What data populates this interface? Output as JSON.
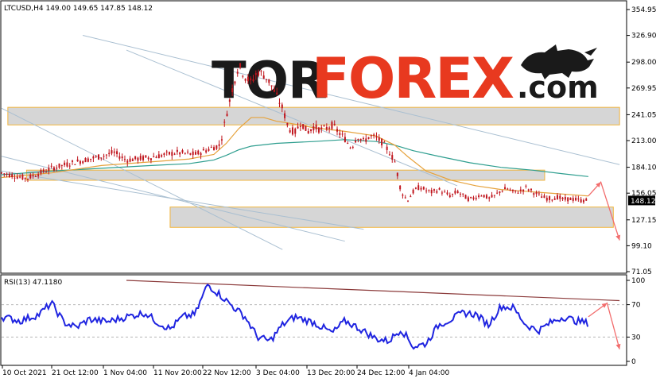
{
  "symbol_header": {
    "text": "LTCUSD,H4  149.00 149.65 147.85 148.12"
  },
  "watermark": {
    "brand_dark": "TOR",
    "brand_red": "FOREX",
    "suffix": ".com",
    "dark_color": "#1a1a1a",
    "red_color": "#e8391f"
  },
  "colors": {
    "background": "#ffffff",
    "candle": "#c0151d",
    "ma_fast": "#e6a23c",
    "ma_slow": "#2e9e8f",
    "zone_fill": "#d6d6d6",
    "zone_stroke": "#f0b43c",
    "trendline": "#a9bfd1",
    "arrow": "#f26d6d",
    "rsi_line": "#1f24e0",
    "rsi_trend": "#8b3a3a",
    "grid_dash": "#b8b8b8"
  },
  "chart_data": [
    {
      "type": "line",
      "title": "LTCUSD,H4",
      "ohlc_last": {
        "open": 149.0,
        "high": 149.65,
        "low": 147.85,
        "close": 148.12
      },
      "current_price_label": "148.12",
      "y_ticks": [
        "354.95",
        "326.90",
        "298.00",
        "269.95",
        "241.05",
        "213.00",
        "184.10",
        "156.05",
        "127.15",
        "99.10",
        "71.05"
      ],
      "y_tick_values": [
        354.95,
        326.9,
        298.0,
        269.95,
        241.05,
        213.0,
        184.1,
        156.05,
        127.15,
        99.1,
        71.05
      ],
      "ylim": [
        71.05,
        354.95
      ],
      "x_ticks": [
        "10 Oct 2021",
        "21 Oct 12:00",
        "1 Nov 04:00",
        "11 Nov 20:00",
        "22 Nov 12:00",
        "3 Dec 04:00",
        "13 Dec 20:00",
        "24 Dec 12:00",
        "4 Jan 04:00"
      ],
      "price_path": [
        [
          0,
          178
        ],
        [
          4,
          172
        ],
        [
          8,
          183
        ],
        [
          12,
          190
        ],
        [
          16,
          196
        ],
        [
          18,
          200
        ],
        [
          20,
          192
        ],
        [
          24,
          195
        ],
        [
          28,
          200
        ],
        [
          31,
          198
        ],
        [
          34,
          206
        ],
        [
          35,
          208
        ],
        [
          36,
          240
        ],
        [
          37,
          270
        ],
        [
          38,
          295
        ],
        [
          39,
          282
        ],
        [
          40,
          276
        ],
        [
          41,
          288
        ],
        [
          42,
          284
        ],
        [
          43,
          276
        ],
        [
          44,
          262
        ],
        [
          45,
          248
        ],
        [
          46,
          226
        ],
        [
          47,
          222
        ],
        [
          48,
          233
        ],
        [
          49,
          222
        ],
        [
          50,
          228
        ],
        [
          51,
          225
        ],
        [
          52,
          226
        ],
        [
          53,
          230
        ],
        [
          54,
          222
        ],
        [
          55,
          215
        ],
        [
          56,
          205
        ],
        [
          57,
          218
        ],
        [
          58,
          212
        ],
        [
          59,
          218
        ],
        [
          60,
          216
        ],
        [
          61,
          211
        ],
        [
          62,
          202
        ],
        [
          63,
          190
        ],
        [
          64,
          158
        ],
        [
          65,
          148
        ],
        [
          66,
          158
        ],
        [
          67,
          163
        ],
        [
          68,
          159
        ],
        [
          69,
          157
        ],
        [
          70,
          160
        ],
        [
          71,
          156
        ],
        [
          72,
          153
        ],
        [
          73,
          158
        ],
        [
          74,
          153
        ],
        [
          75,
          149
        ],
        [
          76,
          152
        ],
        [
          77,
          155
        ],
        [
          78,
          150
        ],
        [
          79,
          153
        ],
        [
          80,
          159
        ],
        [
          81,
          161
        ],
        [
          82,
          157
        ],
        [
          83,
          158
        ],
        [
          84,
          162
        ],
        [
          85,
          158
        ],
        [
          86,
          154
        ],
        [
          87,
          151
        ],
        [
          88,
          150
        ],
        [
          89,
          152
        ],
        [
          90,
          149
        ],
        [
          91,
          150
        ],
        [
          92,
          149
        ],
        [
          93,
          148
        ],
        [
          94,
          148.12
        ]
      ],
      "ma_fast_path": [
        [
          0,
          173
        ],
        [
          8,
          178
        ],
        [
          16,
          186
        ],
        [
          24,
          190
        ],
        [
          30,
          193
        ],
        [
          34,
          198
        ],
        [
          36,
          210
        ],
        [
          38,
          226
        ],
        [
          40,
          238
        ],
        [
          42,
          238
        ],
        [
          44,
          234
        ],
        [
          46,
          232
        ],
        [
          50,
          227
        ],
        [
          55,
          223
        ],
        [
          60,
          218
        ],
        [
          63,
          208
        ],
        [
          65,
          196
        ],
        [
          68,
          180
        ],
        [
          72,
          170
        ],
        [
          76,
          164
        ],
        [
          80,
          160
        ],
        [
          84,
          158
        ],
        [
          88,
          156
        ],
        [
          92,
          154
        ],
        [
          94,
          153
        ]
      ],
      "ma_slow_path": [
        [
          0,
          176
        ],
        [
          8,
          180
        ],
        [
          16,
          183
        ],
        [
          24,
          186
        ],
        [
          30,
          188
        ],
        [
          34,
          192
        ],
        [
          36,
          197
        ],
        [
          38,
          203
        ],
        [
          40,
          207
        ],
        [
          44,
          210
        ],
        [
          50,
          212
        ],
        [
          55,
          214
        ],
        [
          60,
          212
        ],
        [
          63,
          208
        ],
        [
          66,
          202
        ],
        [
          70,
          196
        ],
        [
          75,
          189
        ],
        [
          80,
          184
        ],
        [
          85,
          181
        ],
        [
          90,
          177
        ],
        [
          94,
          174
        ]
      ],
      "zones": [
        {
          "top": 249,
          "bottom": 230,
          "start": 1,
          "end": 99
        },
        {
          "top": 181,
          "bottom": 170,
          "start": 4,
          "end": 87
        },
        {
          "top": 141,
          "bottom": 119,
          "start": 27,
          "end": 98
        }
      ],
      "trendlines": [
        {
          "from": [
            13,
            327
          ],
          "to": [
            99,
            187
          ]
        },
        {
          "from": [
            20,
            311
          ],
          "to": [
            73,
            164
          ]
        },
        {
          "from": [
            0,
            248
          ],
          "to": [
            45,
            95
          ]
        },
        {
          "from": [
            0,
            196
          ],
          "to": [
            55,
            104
          ]
        },
        {
          "from": [
            0,
            180
          ],
          "to": [
            58,
            117
          ]
        }
      ],
      "forecast_arrow": [
        [
          94,
          153
        ],
        [
          96,
          168
        ],
        [
          99,
          105
        ]
      ]
    },
    {
      "type": "line",
      "title": "RSI(13) 47.1180",
      "y_ticks": [
        "100",
        "70",
        "30",
        "0"
      ],
      "y_tick_values": [
        100,
        70,
        30,
        0
      ],
      "ylim": [
        0,
        100
      ],
      "levels": [
        70,
        30
      ],
      "rsi_path": [
        [
          0,
          55
        ],
        [
          3,
          50
        ],
        [
          6,
          58
        ],
        [
          8,
          72
        ],
        [
          10,
          48
        ],
        [
          12,
          42
        ],
        [
          14,
          52
        ],
        [
          17,
          49
        ],
        [
          20,
          55
        ],
        [
          23,
          60
        ],
        [
          25,
          48
        ],
        [
          27,
          40
        ],
        [
          29,
          55
        ],
        [
          31,
          58
        ],
        [
          33,
          95
        ],
        [
          35,
          82
        ],
        [
          37,
          68
        ],
        [
          39,
          55
        ],
        [
          41,
          30
        ],
        [
          43,
          25
        ],
        [
          45,
          45
        ],
        [
          47,
          55
        ],
        [
          50,
          48
        ],
        [
          53,
          35
        ],
        [
          55,
          50
        ],
        [
          57,
          42
        ],
        [
          60,
          28
        ],
        [
          62,
          25
        ],
        [
          64,
          40
        ],
        [
          66,
          18
        ],
        [
          68,
          22
        ],
        [
          70,
          45
        ],
        [
          72,
          52
        ],
        [
          74,
          60
        ],
        [
          76,
          58
        ],
        [
          78,
          45
        ],
        [
          80,
          68
        ],
        [
          82,
          66
        ],
        [
          84,
          45
        ],
        [
          86,
          38
        ],
        [
          88,
          48
        ],
        [
          90,
          55
        ],
        [
          92,
          50
        ],
        [
          94,
          47.118
        ]
      ],
      "rsi_trend": {
        "from": [
          20,
          100
        ],
        "to": [
          99,
          75
        ]
      },
      "forecast_arrow": [
        [
          94,
          55
        ],
        [
          97,
          72
        ],
        [
          99,
          15
        ]
      ]
    }
  ]
}
